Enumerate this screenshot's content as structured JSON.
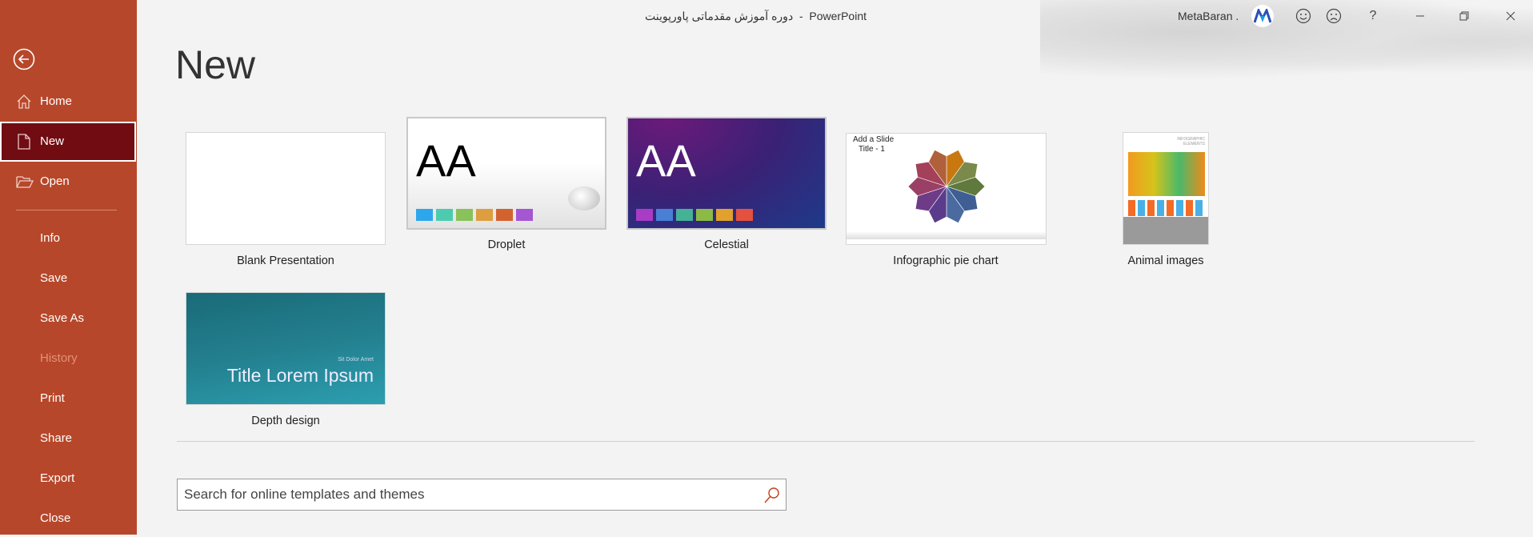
{
  "titlebar": {
    "document": "دوره آموزش مقدماتی پاورپوینت",
    "separator": "-",
    "app": "PowerPoint",
    "user": "MetaBaran .",
    "help": "?"
  },
  "sidebar": {
    "items": [
      {
        "label": "Home",
        "icon": "home-icon"
      },
      {
        "label": "New",
        "icon": "new-file-icon",
        "selected": true
      },
      {
        "label": "Open",
        "icon": "folder-open-icon"
      },
      {
        "label": "Info"
      },
      {
        "label": "Save"
      },
      {
        "label": "Save As"
      },
      {
        "label": "History",
        "disabled": true
      },
      {
        "label": "Print"
      },
      {
        "label": "Share"
      },
      {
        "label": "Export"
      },
      {
        "label": "Close"
      }
    ]
  },
  "main": {
    "title": "New",
    "templates": [
      {
        "label": "Blank Presentation"
      },
      {
        "label": "Droplet",
        "preview": "AA"
      },
      {
        "label": "Celestial",
        "preview": "AA"
      },
      {
        "label": "Infographic pie chart",
        "preview_title": "Add a Slide",
        "preview_subtitle": "Title - 1"
      },
      {
        "label": "Animal images",
        "preview_title": "INFOGRAPHIC ELEMENTS"
      },
      {
        "label": "Depth design",
        "preview_title": "Title Lorem Ipsum",
        "preview_subtitle": "Sit Dolor Amet"
      }
    ],
    "search": {
      "placeholder": "Search for online templates and themes"
    }
  },
  "colors": {
    "sidebar": "#b7472a",
    "selected": "#710c13",
    "accent": "#c43e1c",
    "droplet_swatches": [
      "#2ea6ec",
      "#4ccbae",
      "#89c15a",
      "#de9d3f",
      "#d2632f",
      "#a456d3"
    ],
    "celestial_swatches": [
      "#a83cc4",
      "#4a7fd6",
      "#45b296",
      "#8cbb45",
      "#e2a02d",
      "#e4513f"
    ]
  }
}
